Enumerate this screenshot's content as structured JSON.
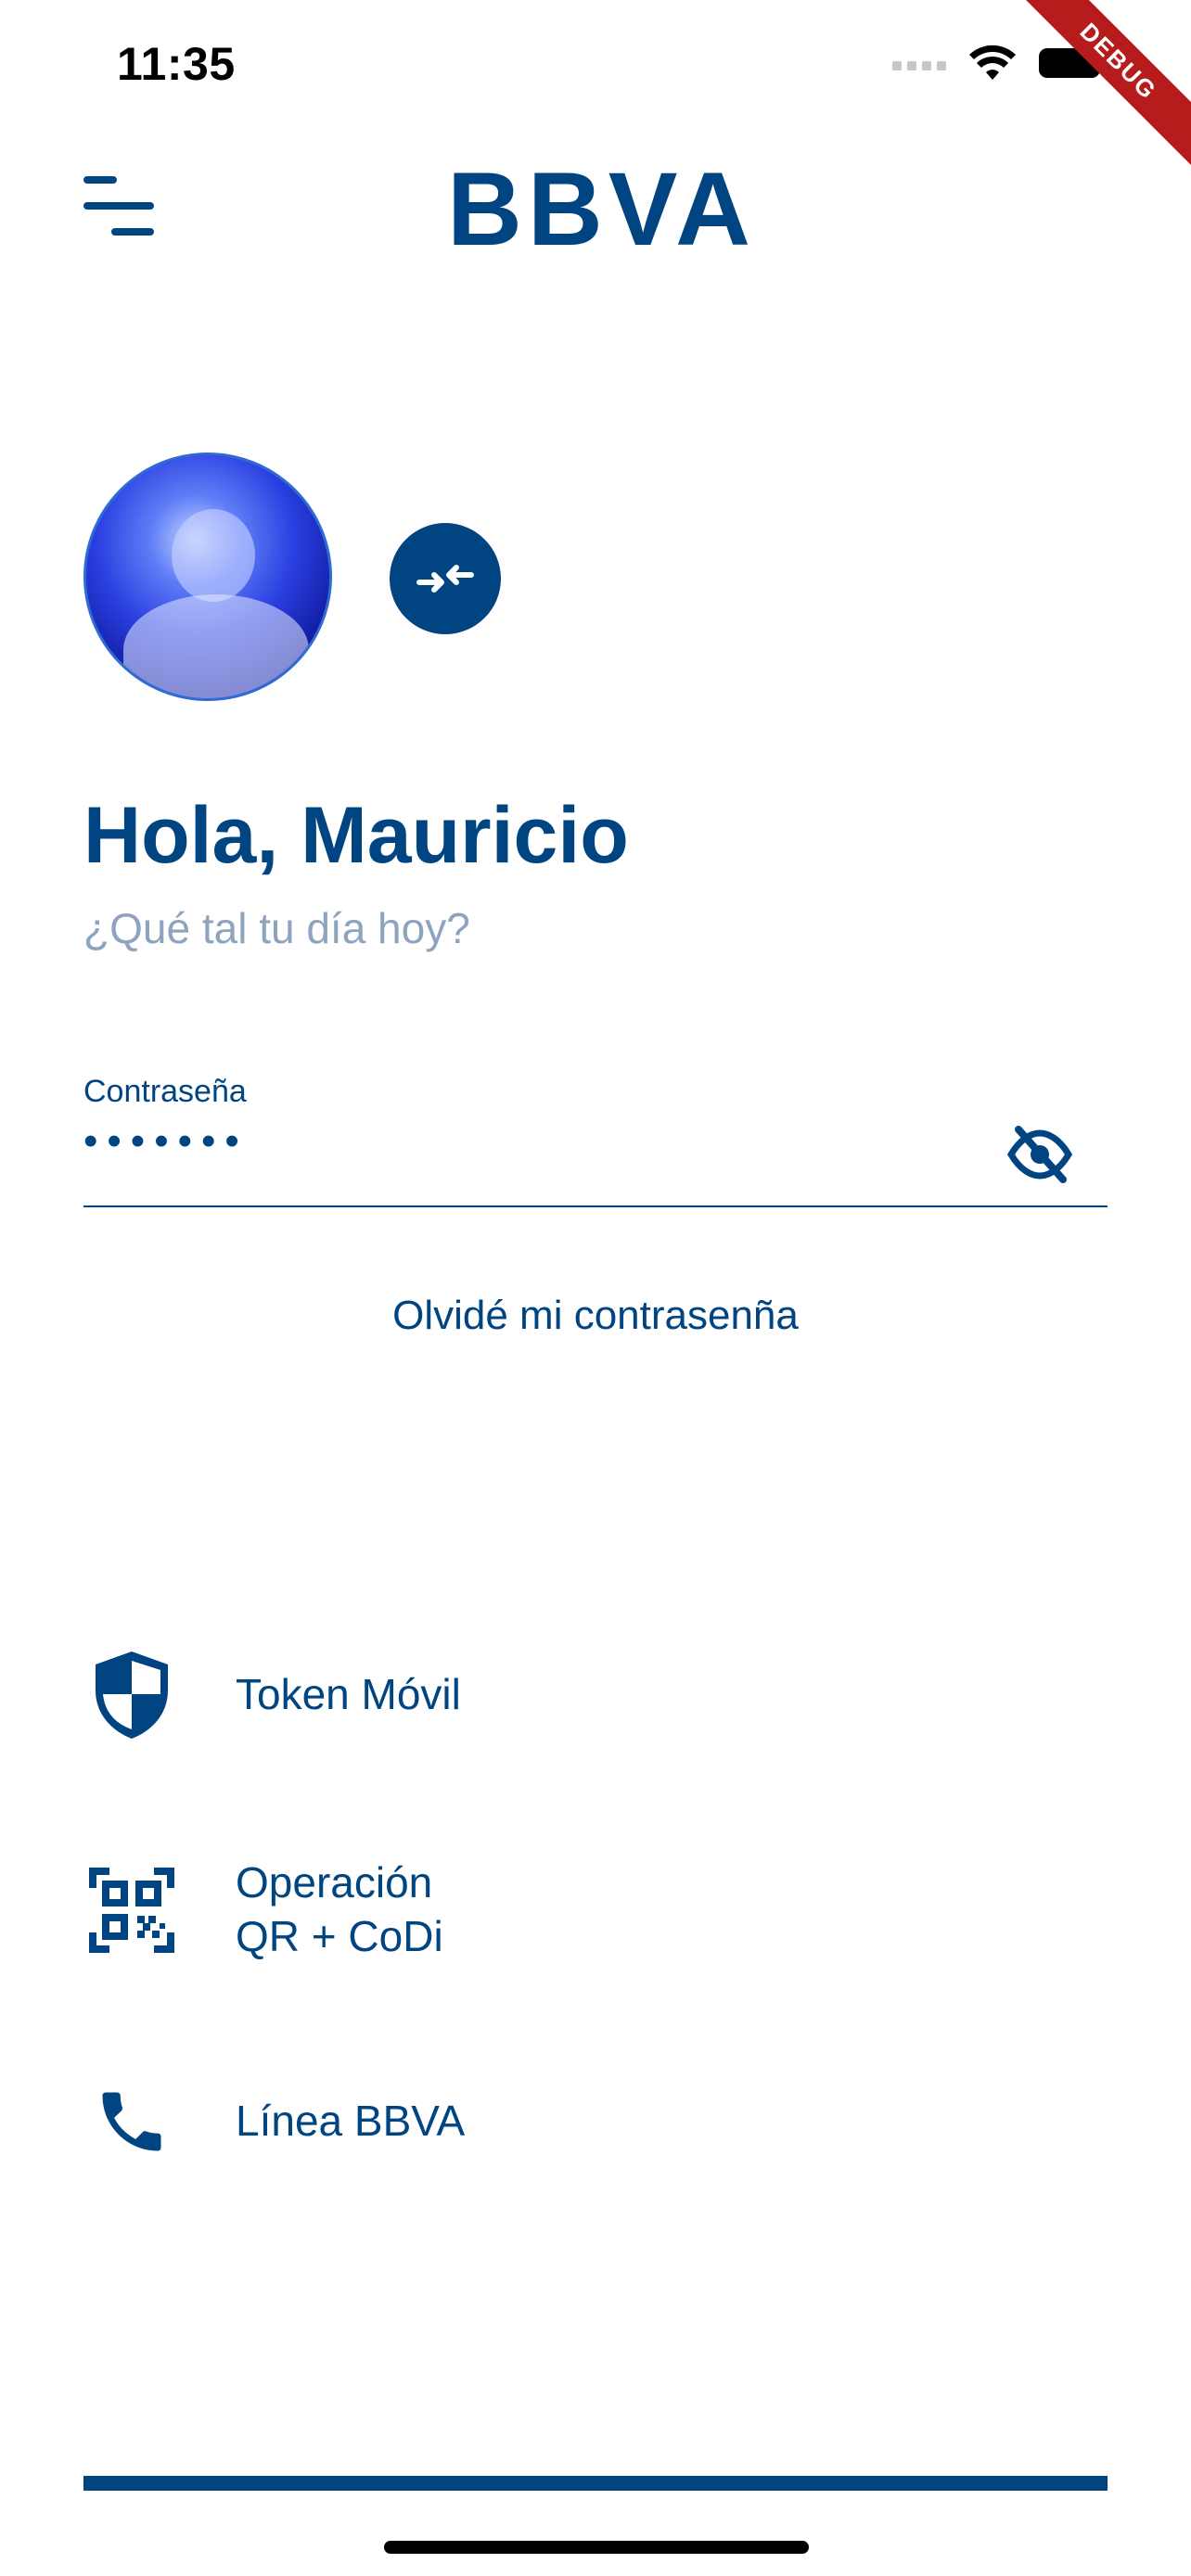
{
  "status_bar": {
    "time": "11:35",
    "debug_label": "DEBUG"
  },
  "header": {
    "brand": "BBVA",
    "menu_icon": "menu-icon"
  },
  "profile": {
    "greeting": "Hola, Mauricio",
    "subtitle": "¿Qué tal tu día hoy?"
  },
  "password": {
    "label": "Contraseña",
    "value": "•••••••",
    "toggle_icon": "eye-off-icon"
  },
  "forgot_link": "Olvidé mi contrasenña",
  "options": [
    {
      "label": "Token Móvil",
      "icon": "shield-icon"
    },
    {
      "label_line1": "Operación",
      "label_line2": "QR + CoDi",
      "icon": "qr-code-icon"
    },
    {
      "label": "Línea BBVA",
      "icon": "phone-icon"
    }
  ],
  "colors": {
    "primary": "#004481",
    "muted": "#8ea3bd",
    "debug": "#b71c1c"
  }
}
